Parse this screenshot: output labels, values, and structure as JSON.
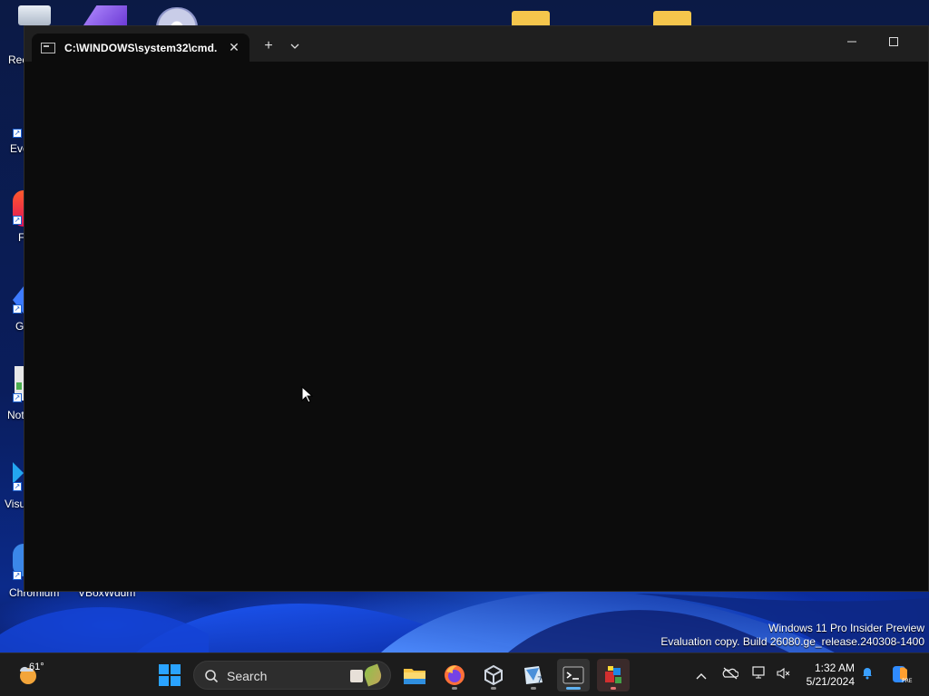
{
  "window": {
    "tab_title": "C:\\WINDOWS\\system32\\cmd.",
    "new_tab": "+",
    "dropdown": "⌄",
    "close_tab": "✕",
    "minimize": "—",
    "maximize": "☐"
  },
  "desktop": {
    "icons": [
      {
        "label": "Rec",
        "name": "recycle-bin"
      },
      {
        "label": "Eve",
        "name": "everything"
      },
      {
        "label": "F",
        "name": "firefox"
      },
      {
        "label": "G",
        "name": "gaming"
      },
      {
        "label": "Not",
        "name": "notepad"
      },
      {
        "label": "Visu",
        "name": "visual-studio-code"
      },
      {
        "label": "Chromium",
        "name": "chromium"
      },
      {
        "label": "VBoxWddm",
        "name": "vboxwddm"
      }
    ],
    "watermark_line1": "Windows 11 Pro Insider Preview",
    "watermark_line2": "Evaluation copy. Build 26080.ge_release.240308-1400"
  },
  "taskbar": {
    "weather_temp": "61°",
    "search_label": "Search",
    "time": "1:32 AM",
    "date": "5/21/2024"
  },
  "colors": {
    "terminal_bg": "#0c0c0c",
    "titlebar_bg": "#1f1f1f",
    "taskbar_bg": "#1c1c1c",
    "accent": "#0078d4"
  }
}
